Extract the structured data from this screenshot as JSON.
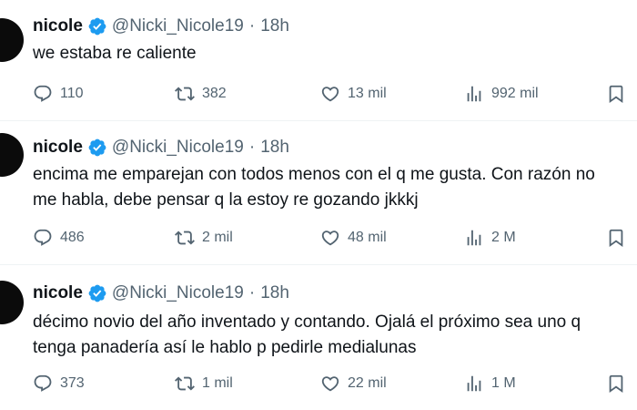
{
  "tweets": [
    {
      "name": "nicole",
      "handle": "@Nicki_Nicole19",
      "dot": "·",
      "time": "18h",
      "text": "we estaba re caliente",
      "replies": "110",
      "retweets": "382",
      "likes": "13 mil",
      "views": "992 mil"
    },
    {
      "name": "nicole",
      "handle": "@Nicki_Nicole19",
      "dot": "·",
      "time": "18h",
      "text": "encima me emparejan con todos menos con el q me gusta. Con razón no\nme habla, debe pensar q la estoy re gozando jkkkj",
      "replies": "486",
      "retweets": "2 mil",
      "likes": "48 mil",
      "views": "2 M"
    },
    {
      "name": "nicole",
      "handle": "@Nicki_Nicole19",
      "dot": "·",
      "time": "18h",
      "text": "décimo novio del año inventado y contando. Ojalá el próximo sea uno q\ntenga panadería así le hablo p pedirle medialunas",
      "replies": "373",
      "retweets": "1 mil",
      "likes": "22 mil",
      "views": "1 M"
    }
  ],
  "colors": {
    "verified": "#1d9bf0",
    "secondary_text": "#536471",
    "divider": "#eff3f4"
  },
  "icons": [
    "reply-icon",
    "retweet-icon",
    "like-icon",
    "views-icon",
    "bookmark-icon",
    "verified-icon"
  ]
}
